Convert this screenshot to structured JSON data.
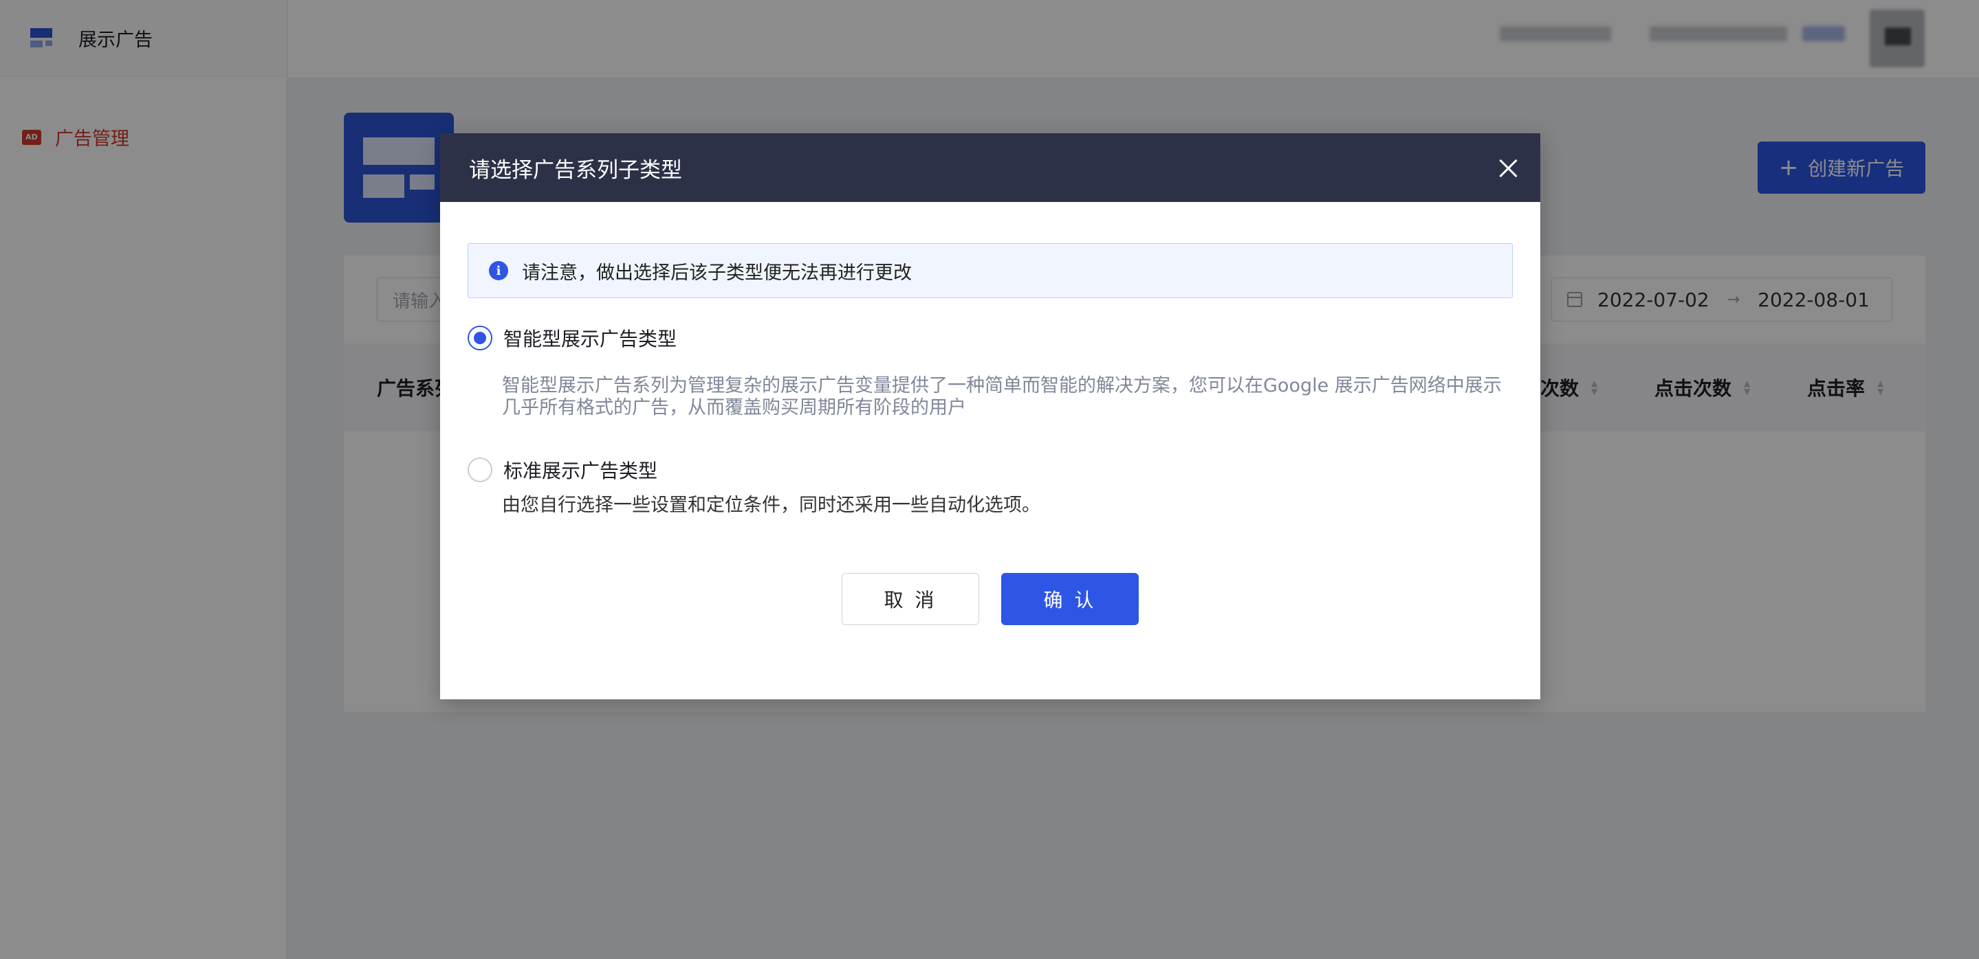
{
  "app": {
    "title": "展示广告"
  },
  "sidebar": {
    "items": [
      {
        "icon": "ad-icon",
        "icon_text": "AD",
        "label": "广告管理",
        "active": true,
        "color": "#d23a2e"
      }
    ]
  },
  "toolbar": {
    "create_label": "创建新广告",
    "create_icon": "plus-icon"
  },
  "filters": {
    "search_placeholder": "请输入",
    "date_start": "2022-07-02",
    "date_end": "2022-08-01"
  },
  "table": {
    "columns": [
      "广告系列",
      "次数",
      "点击次数",
      "点击率"
    ]
  },
  "modal": {
    "title": "请选择广告系列子类型",
    "notice": "请注意，做出选择后该子类型便无法再进行更改",
    "options": [
      {
        "label": "智能型展示广告类型",
        "checked": true,
        "description": "智能型展示广告系列为管理复杂的展示广告变量提供了一种简单而智能的解决方案，您可以在Google 展示广告网络中展示几乎所有格式的广告，从而覆盖购买周期所有阶段的用户"
      },
      {
        "label": "标准展示广告类型",
        "checked": false,
        "description": "由您自行选择一些设置和定位条件，同时还采用一些自动化选项。"
      }
    ],
    "cancel_label": "取 消",
    "confirm_label": "确 认"
  },
  "colors": {
    "primary": "#2d56e6",
    "modal_header": "#2d3148",
    "danger": "#d23a2e"
  }
}
